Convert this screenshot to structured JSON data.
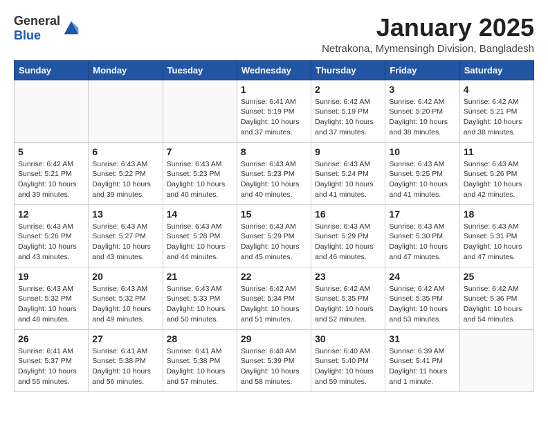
{
  "logo": {
    "general": "General",
    "blue": "Blue"
  },
  "header": {
    "month_title": "January 2025",
    "location": "Netrakona, Mymensingh Division, Bangladesh"
  },
  "days_of_week": [
    "Sunday",
    "Monday",
    "Tuesday",
    "Wednesday",
    "Thursday",
    "Friday",
    "Saturday"
  ],
  "weeks": [
    [
      {
        "day": "",
        "info": ""
      },
      {
        "day": "",
        "info": ""
      },
      {
        "day": "",
        "info": ""
      },
      {
        "day": "1",
        "info": "Sunrise: 6:41 AM\nSunset: 5:19 PM\nDaylight: 10 hours\nand 37 minutes."
      },
      {
        "day": "2",
        "info": "Sunrise: 6:42 AM\nSunset: 5:19 PM\nDaylight: 10 hours\nand 37 minutes."
      },
      {
        "day": "3",
        "info": "Sunrise: 6:42 AM\nSunset: 5:20 PM\nDaylight: 10 hours\nand 38 minutes."
      },
      {
        "day": "4",
        "info": "Sunrise: 6:42 AM\nSunset: 5:21 PM\nDaylight: 10 hours\nand 38 minutes."
      }
    ],
    [
      {
        "day": "5",
        "info": "Sunrise: 6:42 AM\nSunset: 5:21 PM\nDaylight: 10 hours\nand 39 minutes."
      },
      {
        "day": "6",
        "info": "Sunrise: 6:43 AM\nSunset: 5:22 PM\nDaylight: 10 hours\nand 39 minutes."
      },
      {
        "day": "7",
        "info": "Sunrise: 6:43 AM\nSunset: 5:23 PM\nDaylight: 10 hours\nand 40 minutes."
      },
      {
        "day": "8",
        "info": "Sunrise: 6:43 AM\nSunset: 5:23 PM\nDaylight: 10 hours\nand 40 minutes."
      },
      {
        "day": "9",
        "info": "Sunrise: 6:43 AM\nSunset: 5:24 PM\nDaylight: 10 hours\nand 41 minutes."
      },
      {
        "day": "10",
        "info": "Sunrise: 6:43 AM\nSunset: 5:25 PM\nDaylight: 10 hours\nand 41 minutes."
      },
      {
        "day": "11",
        "info": "Sunrise: 6:43 AM\nSunset: 5:26 PM\nDaylight: 10 hours\nand 42 minutes."
      }
    ],
    [
      {
        "day": "12",
        "info": "Sunrise: 6:43 AM\nSunset: 5:26 PM\nDaylight: 10 hours\nand 43 minutes."
      },
      {
        "day": "13",
        "info": "Sunrise: 6:43 AM\nSunset: 5:27 PM\nDaylight: 10 hours\nand 43 minutes."
      },
      {
        "day": "14",
        "info": "Sunrise: 6:43 AM\nSunset: 5:28 PM\nDaylight: 10 hours\nand 44 minutes."
      },
      {
        "day": "15",
        "info": "Sunrise: 6:43 AM\nSunset: 5:29 PM\nDaylight: 10 hours\nand 45 minutes."
      },
      {
        "day": "16",
        "info": "Sunrise: 6:43 AM\nSunset: 5:29 PM\nDaylight: 10 hours\nand 46 minutes."
      },
      {
        "day": "17",
        "info": "Sunrise: 6:43 AM\nSunset: 5:30 PM\nDaylight: 10 hours\nand 47 minutes."
      },
      {
        "day": "18",
        "info": "Sunrise: 6:43 AM\nSunset: 5:31 PM\nDaylight: 10 hours\nand 47 minutes."
      }
    ],
    [
      {
        "day": "19",
        "info": "Sunrise: 6:43 AM\nSunset: 5:32 PM\nDaylight: 10 hours\nand 48 minutes."
      },
      {
        "day": "20",
        "info": "Sunrise: 6:43 AM\nSunset: 5:32 PM\nDaylight: 10 hours\nand 49 minutes."
      },
      {
        "day": "21",
        "info": "Sunrise: 6:43 AM\nSunset: 5:33 PM\nDaylight: 10 hours\nand 50 minutes."
      },
      {
        "day": "22",
        "info": "Sunrise: 6:42 AM\nSunset: 5:34 PM\nDaylight: 10 hours\nand 51 minutes."
      },
      {
        "day": "23",
        "info": "Sunrise: 6:42 AM\nSunset: 5:35 PM\nDaylight: 10 hours\nand 52 minutes."
      },
      {
        "day": "24",
        "info": "Sunrise: 6:42 AM\nSunset: 5:35 PM\nDaylight: 10 hours\nand 53 minutes."
      },
      {
        "day": "25",
        "info": "Sunrise: 6:42 AM\nSunset: 5:36 PM\nDaylight: 10 hours\nand 54 minutes."
      }
    ],
    [
      {
        "day": "26",
        "info": "Sunrise: 6:41 AM\nSunset: 5:37 PM\nDaylight: 10 hours\nand 55 minutes."
      },
      {
        "day": "27",
        "info": "Sunrise: 6:41 AM\nSunset: 5:38 PM\nDaylight: 10 hours\nand 56 minutes."
      },
      {
        "day": "28",
        "info": "Sunrise: 6:41 AM\nSunset: 5:38 PM\nDaylight: 10 hours\nand 57 minutes."
      },
      {
        "day": "29",
        "info": "Sunrise: 6:40 AM\nSunset: 5:39 PM\nDaylight: 10 hours\nand 58 minutes."
      },
      {
        "day": "30",
        "info": "Sunrise: 6:40 AM\nSunset: 5:40 PM\nDaylight: 10 hours\nand 59 minutes."
      },
      {
        "day": "31",
        "info": "Sunrise: 6:39 AM\nSunset: 5:41 PM\nDaylight: 11 hours\nand 1 minute."
      },
      {
        "day": "",
        "info": ""
      }
    ]
  ]
}
